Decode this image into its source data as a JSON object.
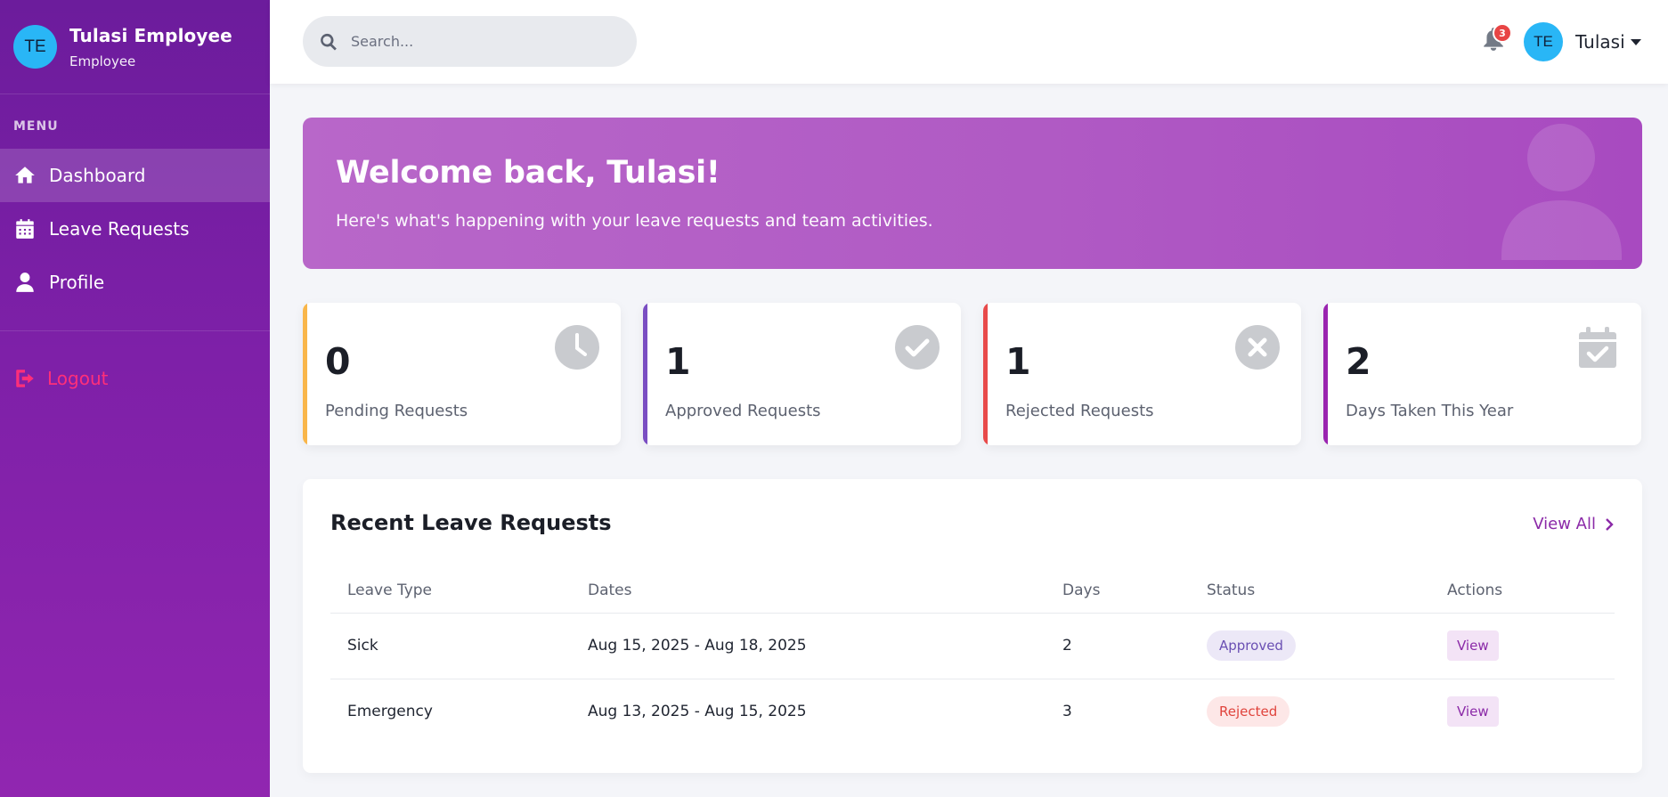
{
  "sidebar": {
    "avatar_initials": "TE",
    "user_name": "Tulasi Employee",
    "user_role": "Employee",
    "menu_label": "MENU",
    "items": [
      {
        "label": "Dashboard",
        "icon": "home-icon",
        "active": true
      },
      {
        "label": "Leave Requests",
        "icon": "calendar-icon",
        "active": false
      },
      {
        "label": "Profile",
        "icon": "user-icon",
        "active": false
      }
    ],
    "logout_label": "Logout"
  },
  "topbar": {
    "search_placeholder": "Search...",
    "notification_count": "3",
    "avatar_initials": "TE",
    "user_name": "Tulasi"
  },
  "banner": {
    "title": "Welcome back, Tulasi!",
    "subtitle": "Here's what's happening with your leave requests and team activities."
  },
  "stats": [
    {
      "value": "0",
      "label": "Pending Requests",
      "accent": "#f9b64a",
      "icon": "clock-icon"
    },
    {
      "value": "1",
      "label": "Approved Requests",
      "accent": "#7a4ec2",
      "icon": "check-circle-icon"
    },
    {
      "value": "1",
      "label": "Rejected Requests",
      "accent": "#e84a4a",
      "icon": "x-circle-icon"
    },
    {
      "value": "2",
      "label": "Days Taken This Year",
      "accent": "#9a24b0",
      "icon": "calendar-check-icon"
    }
  ],
  "recent": {
    "title": "Recent Leave Requests",
    "view_all": "View All",
    "columns": [
      "Leave Type",
      "Dates",
      "Days",
      "Status",
      "Actions"
    ],
    "rows": [
      {
        "type": "Sick",
        "dates": "Aug 15, 2025 - Aug 18, 2025",
        "days": "2",
        "status": "Approved",
        "action": "View"
      },
      {
        "type": "Emergency",
        "dates": "Aug 13, 2025 - Aug 15, 2025",
        "days": "3",
        "status": "Rejected",
        "action": "View"
      }
    ]
  }
}
